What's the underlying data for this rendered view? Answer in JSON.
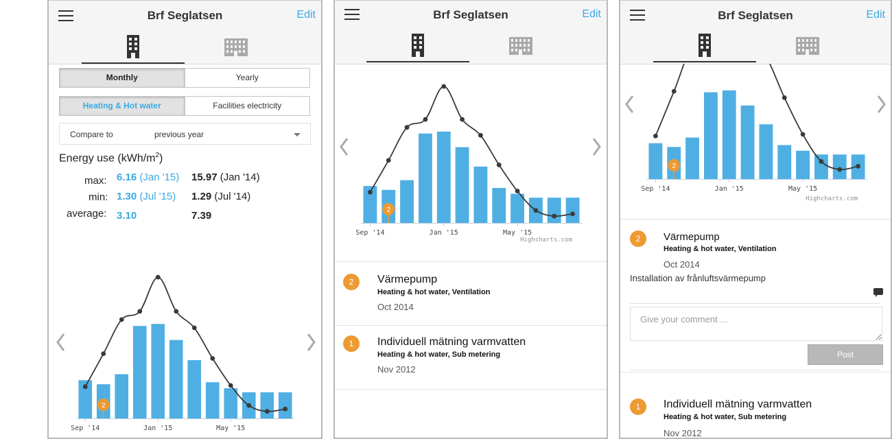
{
  "header": {
    "title": "Brf Seglatsen",
    "edit_label": "Edit"
  },
  "tabs": [
    "building-single-icon",
    "building-group-icon"
  ],
  "period": {
    "options": [
      "Monthly",
      "Yearly"
    ],
    "selected": "Monthly"
  },
  "category": {
    "options": [
      "Heating & Hot water",
      "Facilities electricity"
    ],
    "selected": "Heating & Hot water"
  },
  "compare": {
    "label": "Compare to",
    "value": "previous year"
  },
  "energy": {
    "title": "Energy use (kWh/m",
    "unit_sup": "2",
    "title_end": ")",
    "rows": [
      {
        "label": "max:",
        "cur_value": "6.16",
        "cur_period": "(Jan '15)",
        "prev_value": "15.97",
        "prev_period": "(Jan '14)"
      },
      {
        "label": "min:",
        "cur_value": "1.30",
        "cur_period": "(Jul '15)",
        "prev_value": "1.29",
        "prev_period": "(Jul '14)"
      },
      {
        "label": "average:",
        "cur_value": "3.10",
        "cur_period": "",
        "prev_value": "7.39",
        "prev_period": ""
      }
    ]
  },
  "chart_data": {
    "type": "bar",
    "categories": [
      "Sep '14",
      "Oct '14",
      "Nov '14",
      "Dec '14",
      "Jan '15",
      "Feb '15",
      "Mar '15",
      "Apr '15",
      "May '15",
      "Jun '15",
      "Jul '15",
      "Aug '15"
    ],
    "x_tick_labels": [
      "Sep '14",
      "Jan '15",
      "May '15"
    ],
    "series": [
      {
        "type": "bar",
        "values": [
          1.9,
          1.7,
          2.2,
          4.6,
          4.7,
          3.9,
          2.9,
          1.8,
          1.5,
          1.3,
          1.3,
          1.3
        ],
        "color": "#4fafe3"
      },
      {
        "type": "line",
        "values": [
          2.7,
          5.5,
          8.4,
          9.1,
          12.0,
          9.1,
          7.7,
          5.1,
          2.8,
          1.1,
          0.6,
          0.8
        ],
        "color": "#3a3a3a"
      }
    ],
    "marker": {
      "label": "2",
      "category": "Oct '14",
      "color": "#ed9a33"
    },
    "credit": "Highcharts.com"
  },
  "events": [
    {
      "badge": "2",
      "title": "Värmepump",
      "subtitle": "Heating & hot water, Ventilation",
      "date": "Oct 2014",
      "description": "Installation av frånluftsvärmepump"
    },
    {
      "badge": "1",
      "title": "Individuell mätning varmvatten",
      "subtitle": "Heating & hot water, Sub metering",
      "date": "Nov 2012"
    }
  ],
  "comment": {
    "placeholder": "Give your comment ...",
    "post_label": "Post"
  },
  "colors": {
    "accent": "#3ca9e2",
    "bar": "#4fafe3",
    "badge": "#ed9a33",
    "line": "#3a3a3a"
  }
}
